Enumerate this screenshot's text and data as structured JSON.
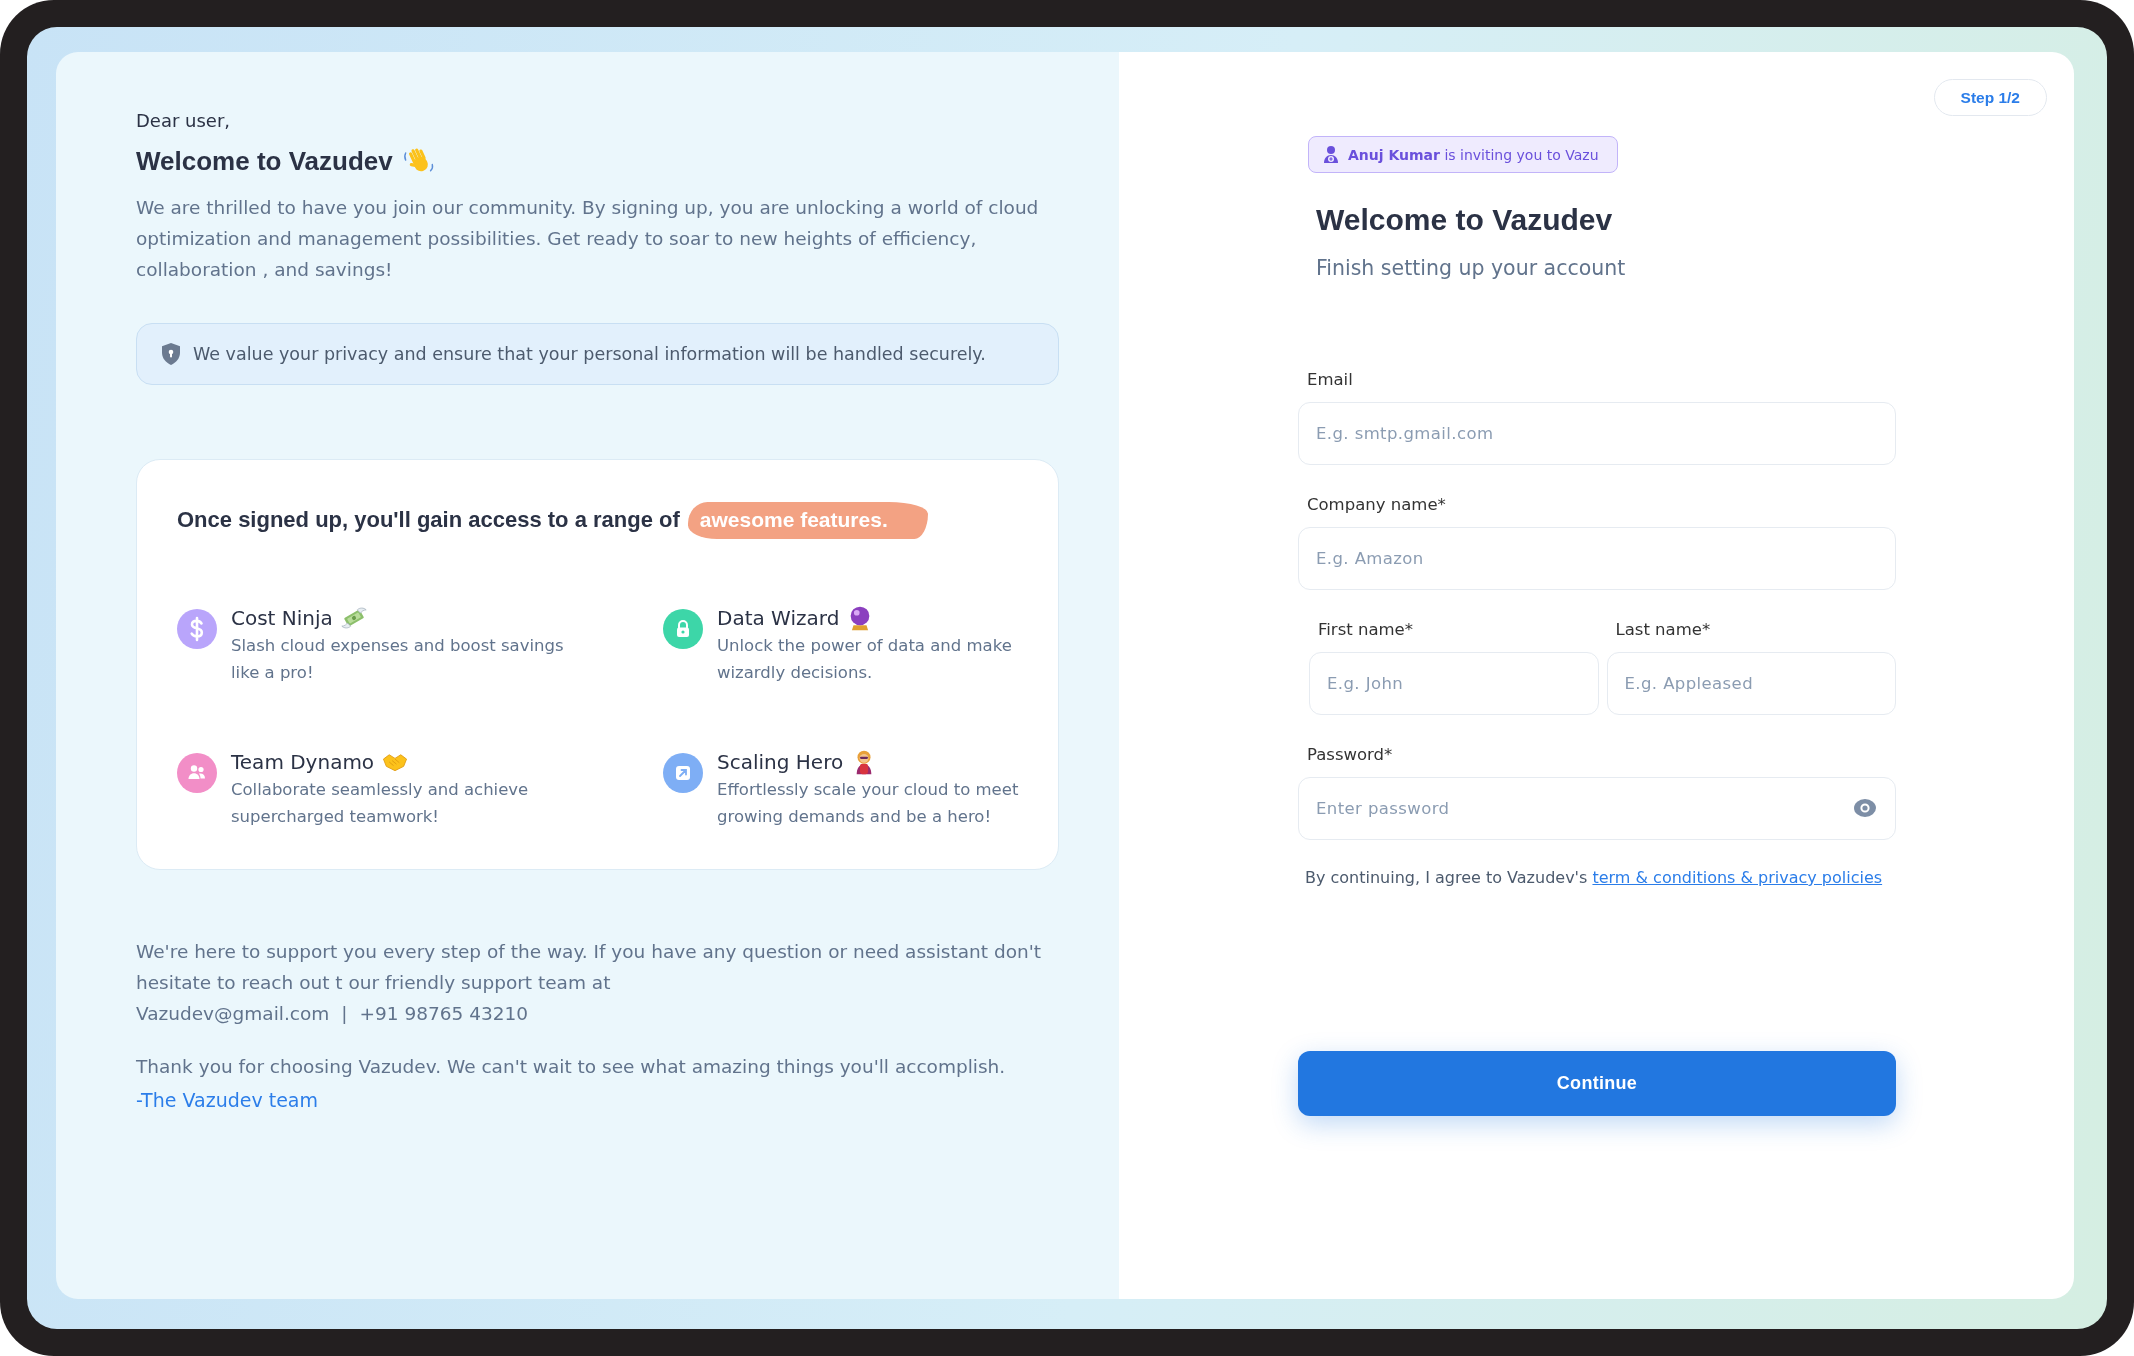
{
  "letter": {
    "greeting": "Dear user,",
    "title": "Welcome to Vazudev",
    "intro": "We are thrilled to have you join our community. By signing up, you are unlocking a world of cloud optimization and management possibilities. Get ready to soar to new heights of efficiency, collaboration , and savings!",
    "privacy_notice": "We value your privacy and ensure that your personal information will be handled securely."
  },
  "features_card": {
    "heading": "Once signed up, you'll gain access to a range of",
    "highlight": "awesome features.",
    "features": [
      {
        "title": "Cost Ninja",
        "description": "Slash cloud expenses and boost savings like a pro!",
        "color": "#b9a5fb"
      },
      {
        "title": "Data Wizard",
        "description": "Unlock the power of data and make wizardly decisions.",
        "color": "#3dd6a8"
      },
      {
        "title": "Team Dynamo",
        "description": "Collaborate seamlessly and achieve supercharged teamwork!",
        "color": "#f28ec7"
      },
      {
        "title": "Scaling Hero",
        "description": "Effortlessly scale your cloud to meet growing demands and be a hero!",
        "color": "#7eaef5"
      }
    ]
  },
  "support": {
    "text": "We're here to support you every step of the way. If you have any question or need assistant don't hesitate to reach out t our friendly support team at",
    "email": "Vazudev@gmail.com",
    "separator": "|",
    "phone": "+91 98765 43210",
    "thanks": "Thank you for choosing Vazudev. We can't wait to see what amazing things you'll accomplish.",
    "signature": "-The Vazudev team"
  },
  "step": "Step 1/2",
  "invite": "**Anuj Kumar** is inviting you to Vazu",
  "form": {
    "title": "Welcome to Vazudev",
    "subtitle": "Finish setting up your account",
    "rows": [
      {
        "fields": [
          {
            "label": "Email",
            "placeholder": "E.g. smtp.gmail.com",
            "kind": "text"
          }
        ]
      },
      {
        "fields": [
          {
            "label": "Company name*",
            "placeholder": "E.g. Amazon",
            "kind": "text"
          }
        ]
      },
      {
        "fields": [
          {
            "label": "First name*",
            "placeholder": "E.g. John",
            "kind": "text"
          },
          {
            "label": "Last name*",
            "placeholder": "E.g. Appleased",
            "kind": "text"
          }
        ]
      },
      {
        "fields": [
          {
            "label": "Password*",
            "placeholder": "Enter password",
            "kind": "password"
          }
        ]
      }
    ],
    "terms": {
      "text": "By continuing, I agree to Vazudev's",
      "link": "term & conditions & privacy policies"
    },
    "submit": "Continue"
  }
}
